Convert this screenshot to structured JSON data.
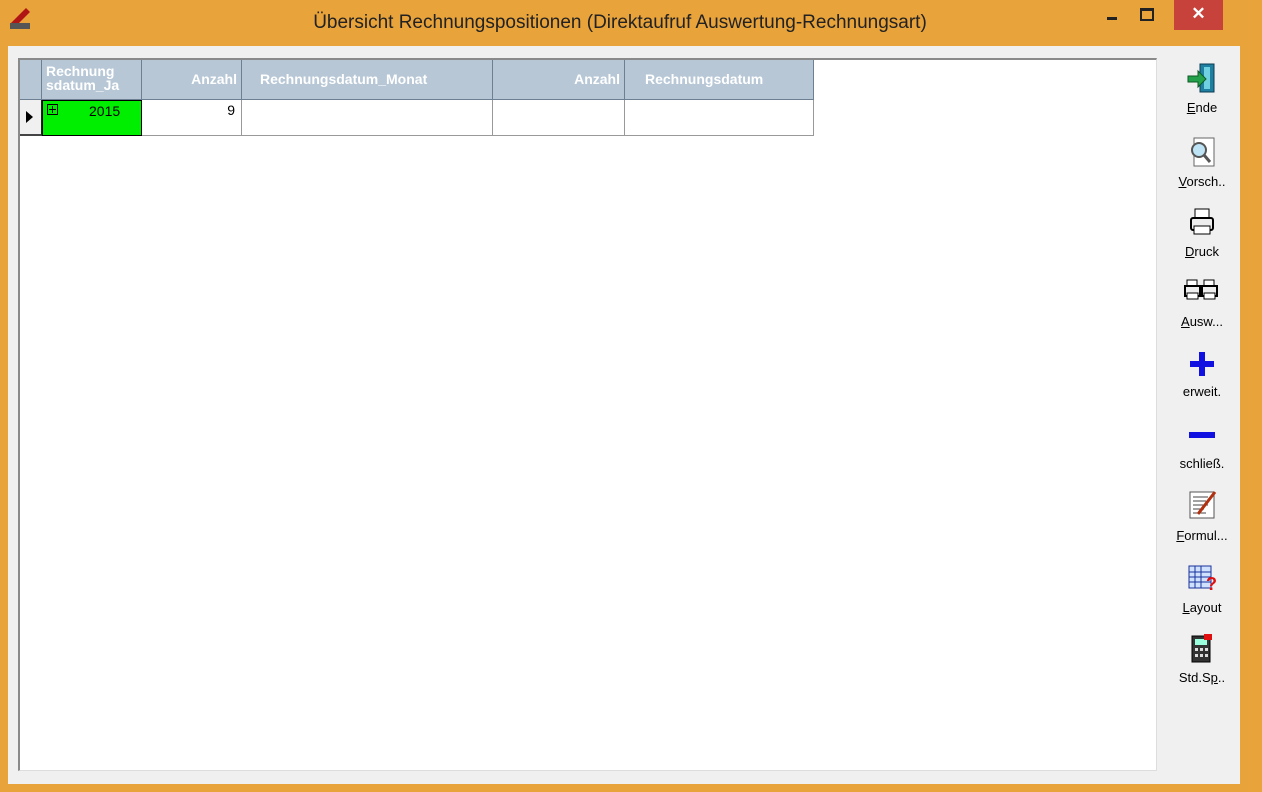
{
  "window": {
    "title": "Übersicht Rechnungspositionen (Direktaufruf Auswertung-Rechnungsart)",
    "close_glyph": "✕",
    "accent": "#e8a33b"
  },
  "grid": {
    "headers": [
      "Rechnung sdatum_Ja",
      "Anzahl",
      "Rechnungsdatum_Monat",
      "Anzahl",
      "Rechnungsdatum"
    ],
    "rows": [
      {
        "year": "2015",
        "count": "9",
        "month": "",
        "count2": "",
        "date": ""
      }
    ],
    "year_cell_color": "#00ee00",
    "header_color": "#b7c7d6"
  },
  "toolbar": {
    "items": [
      {
        "key": "E",
        "rest": "nde",
        "icon": "exit-door-icon"
      },
      {
        "key": "V",
        "rest": "orsch..",
        "icon": "preview-magnifier-icon"
      },
      {
        "key": "D",
        "rest": "ruck",
        "icon": "printer-icon"
      },
      {
        "key": "A",
        "rest": "usw...",
        "icon": "multi-printer-icon"
      },
      {
        "key": "",
        "rest": "erweit.",
        "icon": "plus-icon"
      },
      {
        "key": "",
        "rest": "schließ.",
        "icon": "minus-icon"
      },
      {
        "key": "F",
        "rest": "ormul...",
        "icon": "form-edit-icon"
      },
      {
        "key": "L",
        "rest": "ayout",
        "icon": "layout-grid-icon"
      },
      {
        "prefix": "Std.S",
        "key": "p",
        "rest": "..",
        "icon": "calculator-icon"
      }
    ]
  }
}
